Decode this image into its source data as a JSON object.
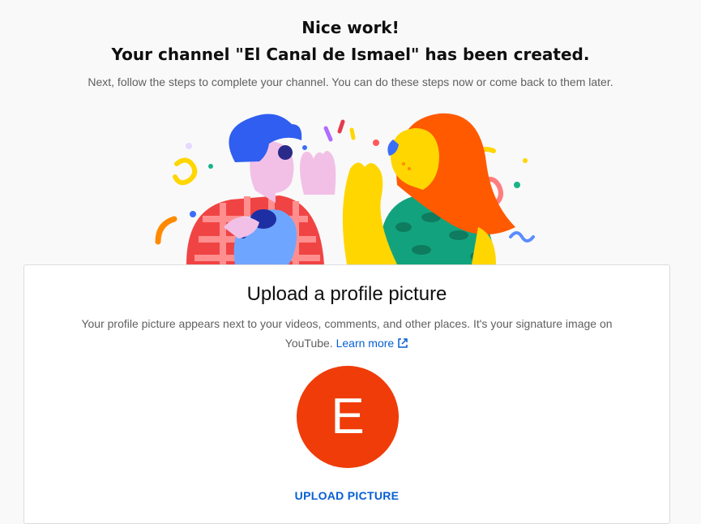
{
  "header": {
    "title_line1": "Nice work!",
    "title_line2": "Your channel \"El Canal de Ismael\" has been created.",
    "subtitle": "Next, follow the steps to complete your channel. You can do these steps now or come back to them later."
  },
  "illustration": {
    "icon": "celebration-illustration"
  },
  "profile_card": {
    "title": "Upload a profile picture",
    "description": "Your profile picture appears next to your videos, comments, and other places. It's your signature image on YouTube.",
    "learn_more": "Learn more",
    "avatar_letter": "E",
    "avatar_color": "#ef3c09",
    "upload_button": "UPLOAD PICTURE",
    "link_color": "#065fd4"
  }
}
